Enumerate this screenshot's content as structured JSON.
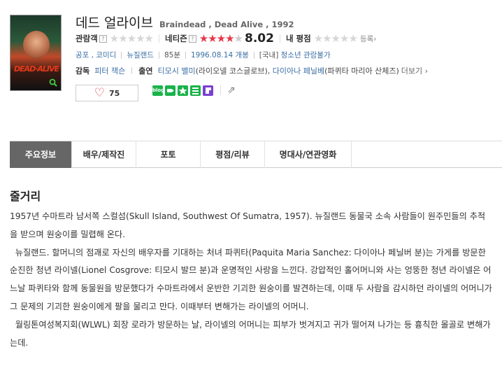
{
  "movie": {
    "title_ko": "데드 얼라이브",
    "title_en": "Braindead , Dead Alive , 1992"
  },
  "ratings": {
    "audience_label": "관람객",
    "audience_stars": "★★★★★",
    "netizen_label": "네티즌",
    "netizen_stars_on": "★★★★",
    "netizen_stars_off": "★",
    "netizen_score": "8.02",
    "my_label": "내 평점",
    "my_stars": "★★★★★",
    "register": "등록",
    "register_arrow": "›",
    "qmark": "?"
  },
  "meta": {
    "genre": "공포 , 코미디",
    "country": "뉴질랜드",
    "runtime": "85분",
    "release": "1996.08.14 개봉",
    "grade_prefix": "[국내]",
    "grade": "청소년 관람불가"
  },
  "credits": {
    "director_label": "감독",
    "director": "피터 잭슨",
    "cast_label": "출연",
    "actor1": "티모시 밸미",
    "actor1_role": "(라이오넬 코스글로브),",
    "actor2": "다이아나 페닐베",
    "actor2_role": "(파퀴타 마리아 산체즈)",
    "more": "더보기",
    "more_arrow": "›"
  },
  "like": {
    "heart": "♡",
    "count": "75"
  },
  "share": {
    "blog": "blog",
    "out_icon": "⇗"
  },
  "tabs": [
    {
      "label": "주요정보"
    },
    {
      "label": "배우/제작진"
    },
    {
      "label": "포토"
    },
    {
      "label": "평점/리뷰"
    },
    {
      "label": "명대사/연관영화"
    }
  ],
  "synopsis": {
    "title": "줄거리",
    "p1": "1957년 수마트라 남서쪽 스컬섬(Skull Island, Southwest Of Sumatra, 1957). 뉴질랜드 동물국 소속 사람들이 원주민들의 추적을 받으며 원숭이를 밀렵해 온다.",
    "p2": "  뉴질랜드. 할머니의 점괘로 자신의 배우자를 기대하는 처녀 파퀴타(Paquita Maria Sanchez: 다이아나 페닐버 분)는 가게를 방문한 순진한 청년 라이넬(Lionel Cosgrove: 티모시 발므 분)과 운명적인 사랑을 느낀다. 강압적인 홀어머니와 사는 엉뚱한 청년 라이넬은 어느날 파퀴타와 함께 동물원을 방문했다가 수마트라에서 운반한 기괴한 원숭이를 발견하는데, 이때 두 사람을 감시하던 라이넬의 어머니가 그 문제의 기괴한 원숭이에게 팔을 물리고 만다. 이때부터 변해가는 라이넬의 어머니.",
    "p3": "  월링톤여성복지회(WLWL) 회장 로라가 방문하는 날, 라이넬의 어머니는 피부가 벗겨지고 귀가 떨어져 나가는 등 흉칙한 몰골로 변해가는데."
  }
}
